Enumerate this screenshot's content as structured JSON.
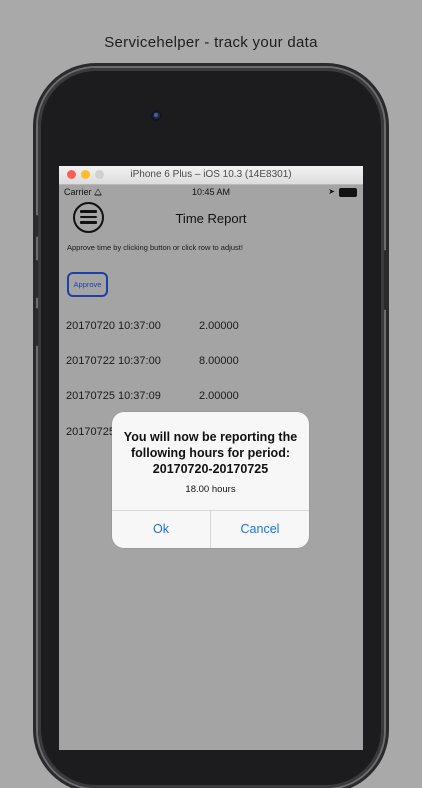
{
  "caption": "Servicehelper - track your data",
  "simulator": {
    "window_title": "iPhone 6 Plus – iOS 10.3 (14E8301)"
  },
  "status_bar": {
    "carrier": "Carrier ⧋",
    "time": "10:45 AM",
    "location_glyph": "➤"
  },
  "nav": {
    "title": "Time Report",
    "menu_icon": "hamburger-menu-icon"
  },
  "content": {
    "instructions": "Approve time by clicking button or click row to adjust!",
    "approve_label": "Approve",
    "rows": [
      {
        "date": "20170720 10:37:00",
        "hours": "2.00000"
      },
      {
        "date": "20170722 10:37:00",
        "hours": "8.00000"
      },
      {
        "date": "20170725 10:37:09",
        "hours": "2.00000"
      },
      {
        "date": "20170725",
        "hours": ""
      }
    ]
  },
  "alert": {
    "title": "You will now be reporting the following hours for period: 20170720-20170725",
    "message": "18.00 hours",
    "ok_label": "Ok",
    "cancel_label": "Cancel"
  },
  "colors": {
    "accent": "#1a73e8",
    "approve_border": "#1f3fa8",
    "background": "#a9a9a9"
  }
}
